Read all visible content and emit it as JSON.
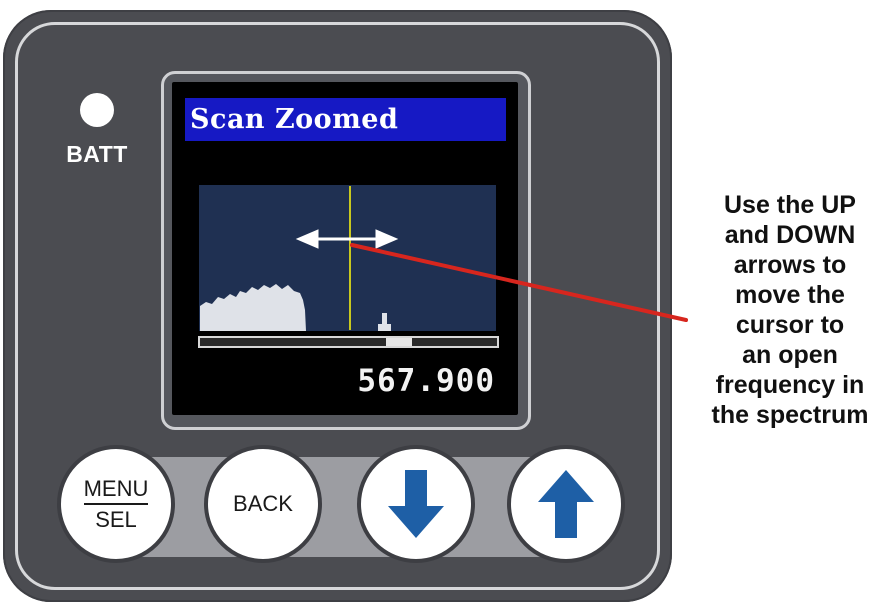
{
  "device": {
    "batt_label": "BATT",
    "screen": {
      "title": "Scan Zoomed",
      "frequency": "567.900",
      "title_bar_color": "#1619c4",
      "cursor_color": "#c8c81e",
      "arrow_icon": "double-headed-arrow-icon"
    },
    "buttons": {
      "menu_top": "MENU",
      "menu_bottom": "SEL",
      "back": "BACK",
      "down_icon": "arrow-down-icon",
      "up_icon": "arrow-up-icon",
      "arrow_color": "#1e5fa6"
    }
  },
  "annotation": {
    "lines": [
      "Use the UP",
      "and DOWN",
      "arrows to",
      "move the",
      "cursor to",
      "an open",
      "frequency in",
      "the spectrum"
    ],
    "pointer_color": "#d7261e"
  }
}
